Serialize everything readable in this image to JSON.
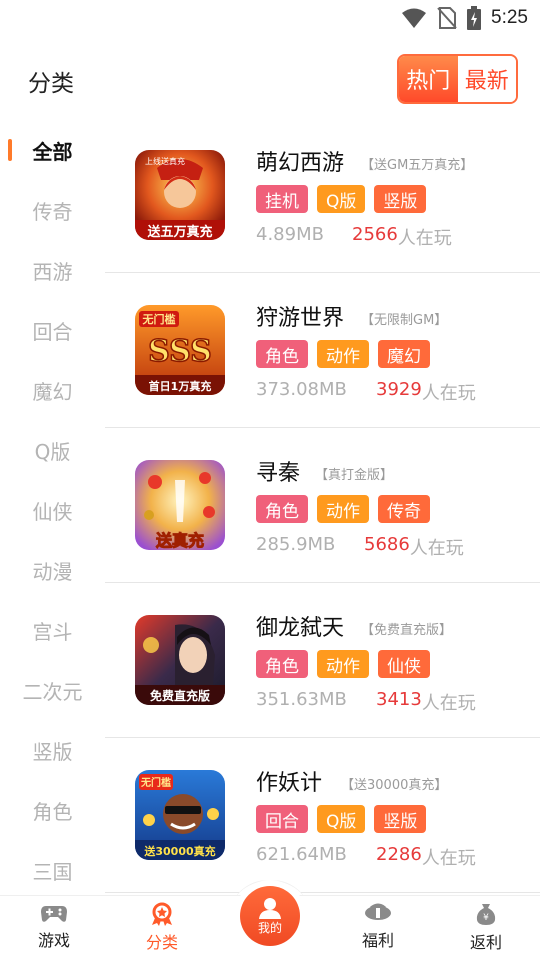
{
  "status_bar": {
    "time": "5:25"
  },
  "header": {
    "title": "分类",
    "sort_options": {
      "hot": "热门",
      "new": "最新"
    }
  },
  "sidebar": {
    "items": [
      {
        "label": "全部",
        "active": true
      },
      {
        "label": "传奇"
      },
      {
        "label": "西游"
      },
      {
        "label": "回合"
      },
      {
        "label": "魔幻"
      },
      {
        "label": "Q版"
      },
      {
        "label": "仙侠"
      },
      {
        "label": "动漫"
      },
      {
        "label": "宫斗"
      },
      {
        "label": "二次元"
      },
      {
        "label": "竖版"
      },
      {
        "label": "角色"
      },
      {
        "label": "三国"
      }
    ]
  },
  "games": [
    {
      "name": "萌幻西游",
      "promo": "【送GM五万真充】",
      "tags": [
        "挂机",
        "Q版",
        "竖版"
      ],
      "size": "4.89MB",
      "players": "2566",
      "players_suffix": "人在玩",
      "icon_caption": "送五万真充",
      "icon_top_text": "上线送真充"
    },
    {
      "name": "狩游世界",
      "promo": "【无限制GM】",
      "tags": [
        "角色",
        "动作",
        "魔幻"
      ],
      "size": "373.08MB",
      "players": "3929",
      "players_suffix": "人在玩",
      "icon_caption": "首日1万真充",
      "icon_top_text": "无门槛"
    },
    {
      "name": "寻秦",
      "promo": "【真打金版】",
      "tags": [
        "角色",
        "动作",
        "传奇"
      ],
      "size": "285.9MB",
      "players": "5686",
      "players_suffix": "人在玩",
      "icon_caption": "送真充",
      "icon_top_text": ""
    },
    {
      "name": "御龙弑天",
      "promo": "【免费直充版】",
      "tags": [
        "角色",
        "动作",
        "仙侠"
      ],
      "size": "351.63MB",
      "players": "3413",
      "players_suffix": "人在玩",
      "icon_caption": "免费直充版",
      "icon_top_text": ""
    },
    {
      "name": "作妖计",
      "promo": "【送30000真充】",
      "tags": [
        "回合",
        "Q版",
        "竖版"
      ],
      "size": "621.64MB",
      "players": "2286",
      "players_suffix": "人在玩",
      "icon_caption": "送30000真充",
      "icon_top_text": "无门槛"
    }
  ],
  "tag_colors": {
    "pink": "#f0607a",
    "orange": "#ff9a1e",
    "red": "#ff6a3a"
  },
  "tab_bar": {
    "tabs": [
      {
        "label": "游戏",
        "icon": "gamepad-icon"
      },
      {
        "label": "分类",
        "icon": "category-icon",
        "active": true
      },
      {
        "label": "我的",
        "icon": "user-icon"
      },
      {
        "label": "福利",
        "icon": "gift-icon"
      },
      {
        "label": "返利",
        "icon": "money-bag-icon"
      }
    ]
  }
}
